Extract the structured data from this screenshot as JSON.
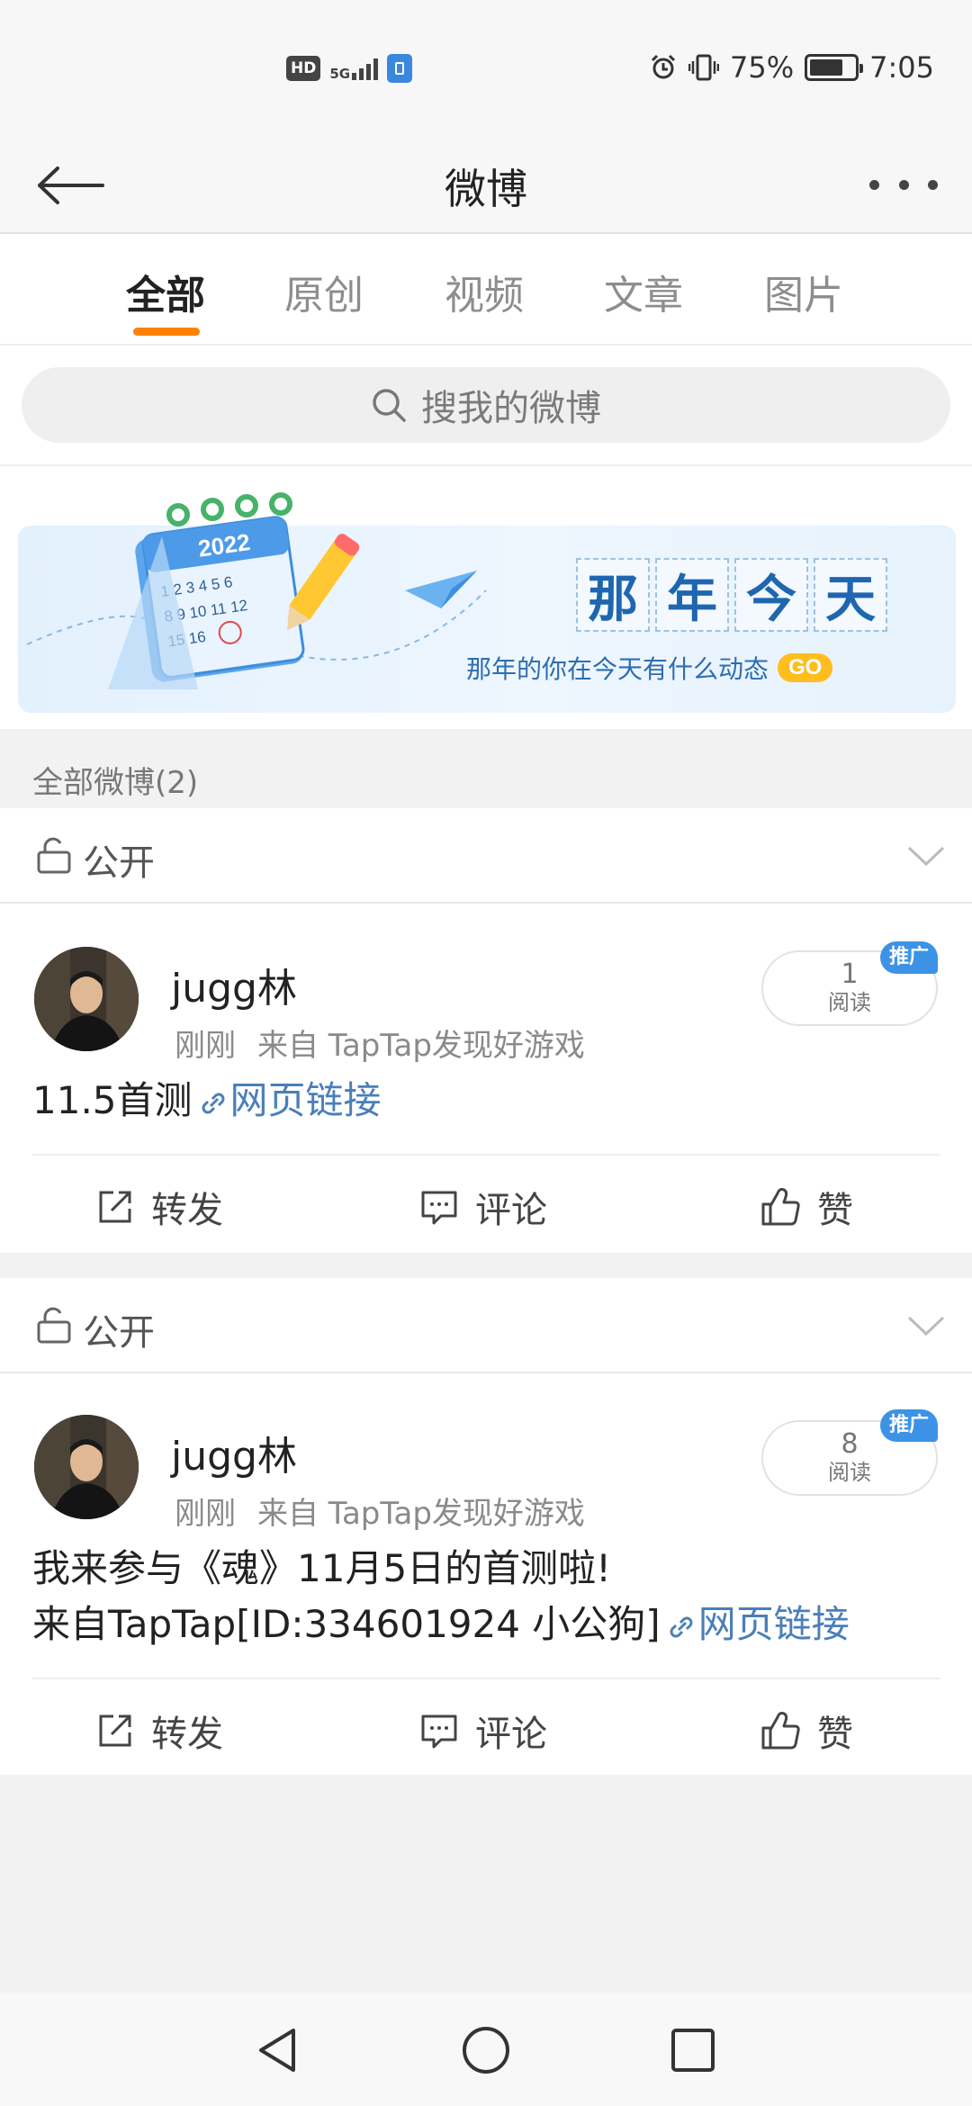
{
  "status_bar": {
    "left_badge": "HD",
    "network": "5G",
    "battery_pct": "75%",
    "battery_level": 0.75,
    "time": "7:05"
  },
  "header": {
    "title": "微博"
  },
  "tabs": [
    {
      "label": "全部",
      "active": true
    },
    {
      "label": "原创",
      "active": false
    },
    {
      "label": "视频",
      "active": false
    },
    {
      "label": "文章",
      "active": false
    },
    {
      "label": "图片",
      "active": false
    }
  ],
  "search": {
    "placeholder": "搜我的微博"
  },
  "banner": {
    "year": "2022",
    "title_chars": [
      "那",
      "年",
      "今",
      "天"
    ],
    "subtitle": "那年的你在今天有什么动态",
    "go_label": "GO"
  },
  "section": {
    "label": "全部微博(2)"
  },
  "posts": [
    {
      "visibility": "公开",
      "user": "jugg林",
      "time": "刚刚",
      "source": "来自 TapTap发现好游戏",
      "reads": "1",
      "reads_label": "阅读",
      "promo": "推广",
      "line1": "11.5首测",
      "line2": "",
      "link_text": "网页链接",
      "repost": "转发",
      "comment": "评论",
      "like": "赞"
    },
    {
      "visibility": "公开",
      "user": "jugg林",
      "time": "刚刚",
      "source": "来自 TapTap发现好游戏",
      "reads": "8",
      "reads_label": "阅读",
      "promo": "推广",
      "line1": "我来参与《魂》11月5日的首测啦!",
      "line2": "来自TapTap[ID:334601924 小公狗]",
      "link_text": "网页链接",
      "repost": "转发",
      "comment": "评论",
      "like": "赞"
    }
  ],
  "icons": {
    "back": "arrow-left-icon",
    "more": "more-dots-icon",
    "search": "search-icon",
    "lock": "unlock-icon",
    "chevron": "chevron-down-icon",
    "link": "link-icon",
    "repost": "share-icon",
    "comment": "comment-icon",
    "like": "thumbs-up-icon"
  },
  "colors": {
    "accent": "#ff8200",
    "link": "#4a7fb8",
    "promo": "#3c93e6"
  }
}
